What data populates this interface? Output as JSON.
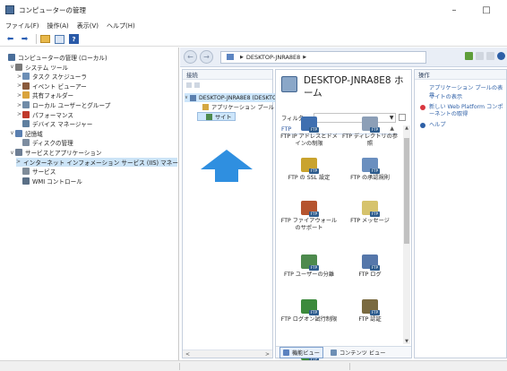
{
  "window": {
    "title": "コンピューターの管理",
    "controls": {
      "minimize": "–",
      "maximize": "□",
      "close": "×"
    }
  },
  "menu": [
    "ファイル(F)",
    "操作(A)",
    "表示(V)",
    "ヘルプ(H)"
  ],
  "toolbar": {
    "buttons": [
      "back-arrow-icon",
      "forward-arrow-icon",
      "folder-icon",
      "show-hide-pane-icon",
      "help-icon"
    ],
    "help_glyph": "?"
  },
  "tree": [
    {
      "label": "コンピューターの管理 (ローカル)",
      "level": 0,
      "expander": "",
      "icon_color": "#4a6e9a"
    },
    {
      "label": "システム ツール",
      "level": 1,
      "expander": "∨",
      "icon_color": "#7a7a7a"
    },
    {
      "label": "タスク スケジューラ",
      "level": 2,
      "expander": ">",
      "icon_color": "#6c8fb7"
    },
    {
      "label": "イベント ビューアー",
      "level": 2,
      "expander": ">",
      "icon_color": "#8a5a3c"
    },
    {
      "label": "共有フォルダー",
      "level": 2,
      "expander": ">",
      "icon_color": "#d9a33c"
    },
    {
      "label": "ローカル ユーザーとグループ",
      "level": 2,
      "expander": ">",
      "icon_color": "#6f8ba8"
    },
    {
      "label": "パフォーマンス",
      "level": 2,
      "expander": ">",
      "icon_color": "#c0392b"
    },
    {
      "label": "デバイス マネージャー",
      "level": 2,
      "expander": "",
      "icon_color": "#5f7f9f"
    },
    {
      "label": "記憶域",
      "level": 1,
      "expander": "∨",
      "icon_color": "#5a7fb0"
    },
    {
      "label": "ディスクの管理",
      "level": 2,
      "expander": "",
      "icon_color": "#7d8da0"
    },
    {
      "label": "サービスとアプリケーション",
      "level": 1,
      "expander": "∨",
      "icon_color": "#6d7e94"
    },
    {
      "label": "インターネット インフォメーション サービス (IIS) マネージャー",
      "level": 2,
      "expander": ">",
      "icon_color": "#3b73b9",
      "selected": true
    },
    {
      "label": "サービス",
      "level": 2,
      "expander": "",
      "icon_color": "#7f8c99"
    },
    {
      "label": "WMI コントロール",
      "level": 2,
      "expander": "",
      "icon_color": "#5a6f86"
    }
  ],
  "iis": {
    "address": {
      "segments": [
        "DESKTOP-JNRA8E8"
      ]
    },
    "connections": {
      "header": "接続",
      "items": [
        {
          "label": "DESKTOP-JNRA8E8 (DESKTOP",
          "level": 0,
          "expander": "∨",
          "selected": true
        },
        {
          "label": "アプリケーション プール",
          "level": 1,
          "expander": ""
        },
        {
          "label": "サイト",
          "level": 1,
          "expander": "",
          "selected": true
        }
      ],
      "scroll_left": "<",
      "scroll_right": ">"
    },
    "features": {
      "title": "DESKTOP-JNRA8E8 ホーム",
      "filter_label": "フィルター:",
      "group": "FTP",
      "items": [
        {
          "label": "FTP IP アドレスとドメインの制限",
          "icon_color": "#3f6fb0"
        },
        {
          "label": "FTP ディレクトリの参照",
          "icon_color": "#8c9fb7"
        },
        {
          "label": "FTP の SSL 設定",
          "icon_color": "#c9a32e"
        },
        {
          "label": "FTP の承認規則",
          "icon_color": "#6a8fbf"
        },
        {
          "label": "FTP ファイアウォールのサポート",
          "icon_color": "#b5542f"
        },
        {
          "label": "FTP メッセージ",
          "icon_color": "#d6c36c"
        },
        {
          "label": "FTP ユーザーの分離",
          "icon_color": "#4d8a4d"
        },
        {
          "label": "FTP ログ",
          "icon_color": "#5577aa"
        },
        {
          "label": "FTP ログオン試行制限",
          "icon_color": "#3c8a3c"
        },
        {
          "label": "FTP 認証",
          "icon_color": "#7a6a40"
        },
        {
          "label": "",
          "icon_color": "#3c8a3c"
        }
      ],
      "ftp_tag": "FTP",
      "tabs": [
        {
          "label": "機能ビュー",
          "active": true,
          "icon_color": "#5b82c0"
        },
        {
          "label": "コンテンツ ビュー",
          "active": false,
          "icon_color": "#6e8fb5"
        }
      ]
    },
    "actions": {
      "header": "操作",
      "items": [
        {
          "label": "アプリケーション プールの表示",
          "bullet": ""
        },
        {
          "label": "サイトの表示",
          "bullet": ""
        },
        {
          "label": "新しい Web Platform コンポーネントの取得",
          "bullet": "#d9363e"
        },
        {
          "label": "ヘルプ",
          "bullet": "#2d5fa6"
        }
      ]
    }
  }
}
